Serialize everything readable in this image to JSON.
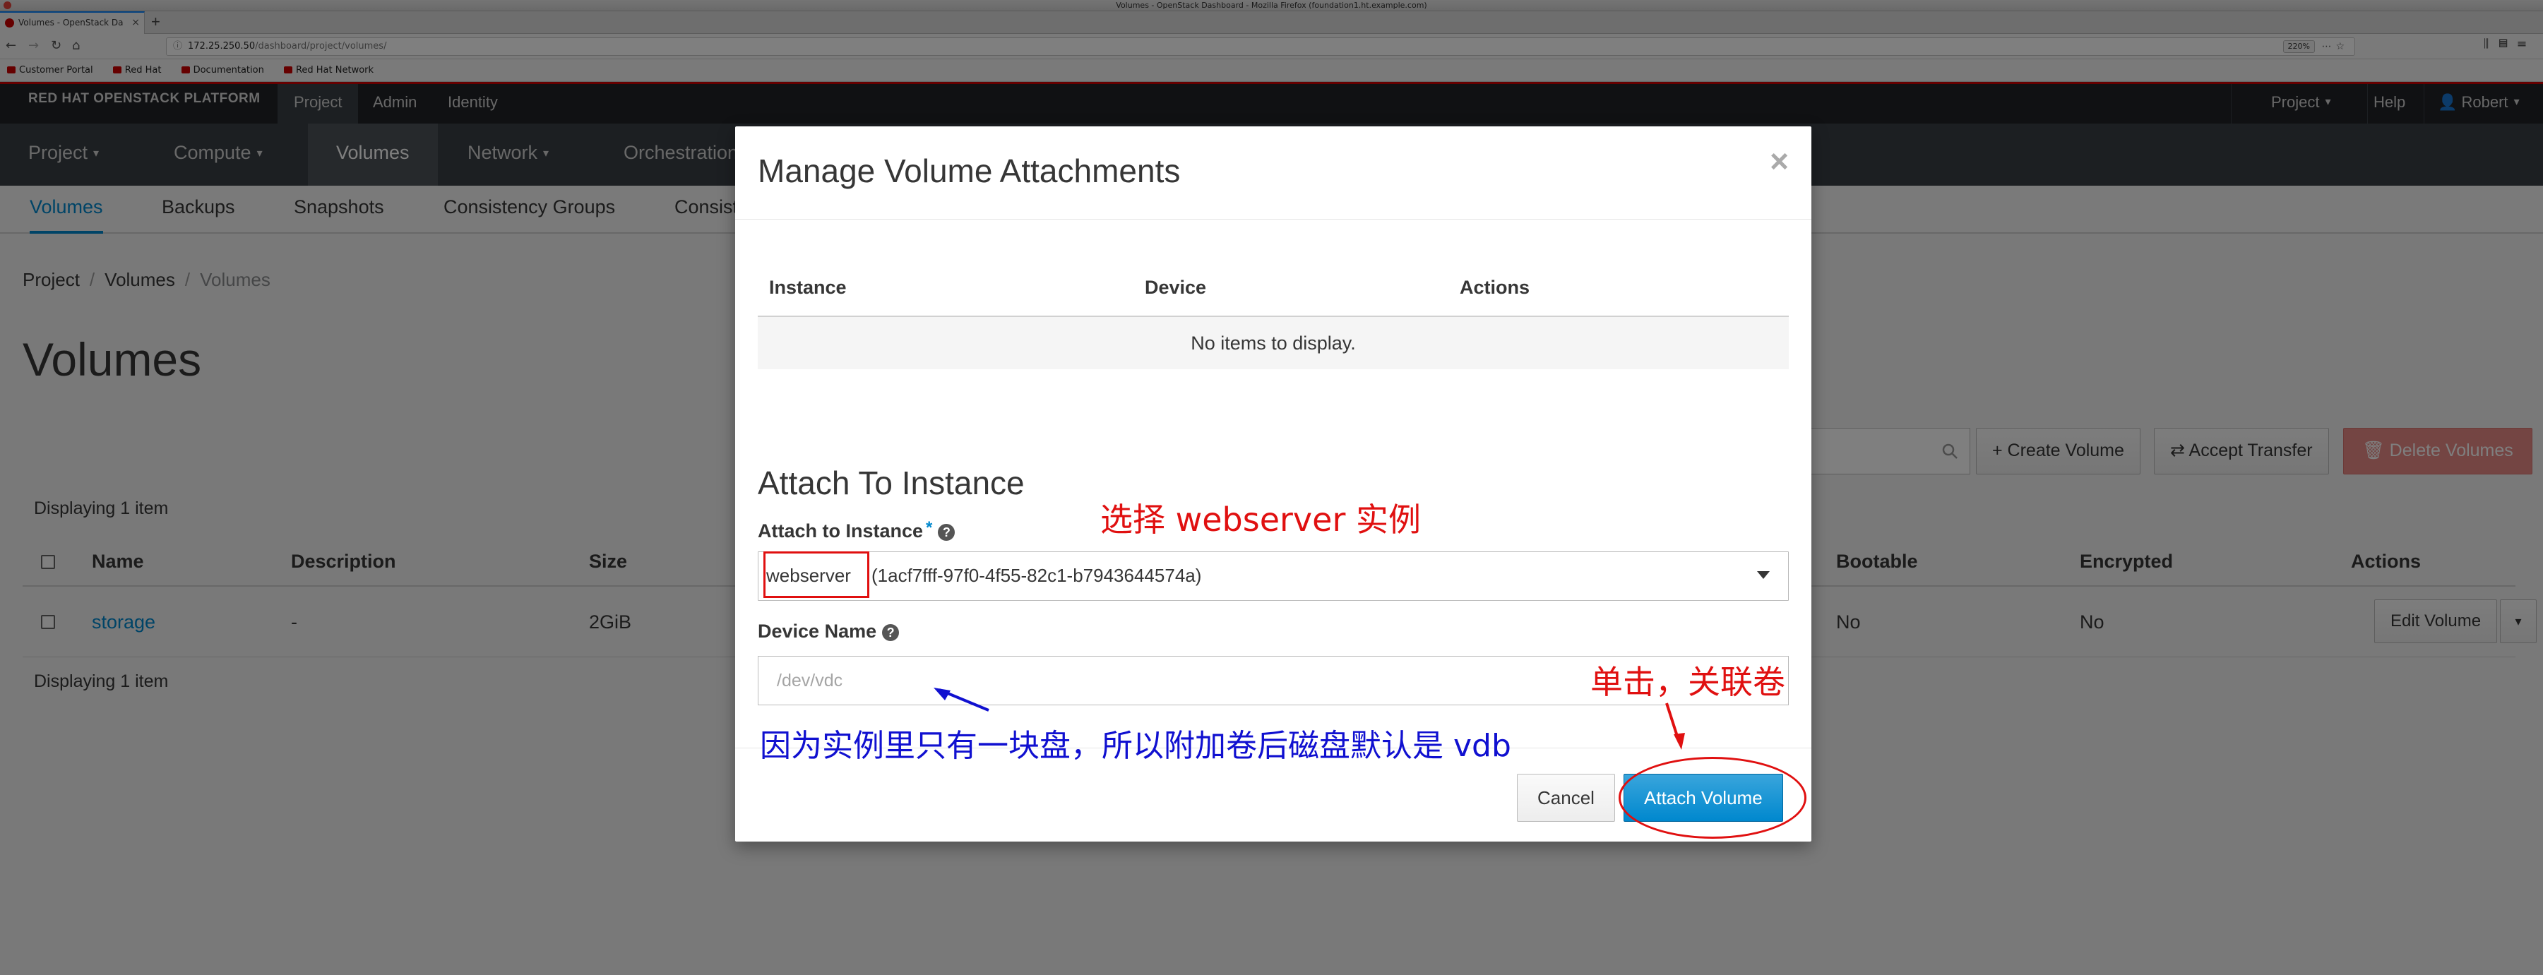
{
  "window": {
    "title": "Volumes - OpenStack Dashboard - Mozilla Firefox (foundation1.ht.example.com)"
  },
  "browser": {
    "tab_title": "Volumes - OpenStack Da",
    "tab_close": "×",
    "new_tab": "+",
    "url_host": "172.25.250.50",
    "url_path": "/dashboard/project/volumes/",
    "zoom": "220%",
    "bookmarks": [
      "Customer Portal",
      "Red Hat",
      "Documentation",
      "Red Hat Network"
    ]
  },
  "topnav": {
    "brand": "RED HAT OPENSTACK PLATFORM",
    "items": [
      "Project",
      "Admin",
      "Identity"
    ],
    "right": {
      "project": "Project",
      "help": "Help",
      "user": "Robert"
    }
  },
  "secnav": {
    "items": [
      "Project",
      "Compute",
      "Volumes",
      "Network",
      "Orchestration"
    ]
  },
  "tertnav": {
    "items": [
      "Volumes",
      "Backups",
      "Snapshots",
      "Consistency Groups",
      "Consist"
    ]
  },
  "page": {
    "breadcrumb": [
      "Project",
      "Volumes",
      "Volumes"
    ],
    "breadcrumb_sep": "/",
    "title": "Volumes",
    "buttons": {
      "create": "+ Create Volume",
      "accept": "⇄ Accept Transfer",
      "delete": "🗑 Delete Volumes"
    },
    "displaying_top": "Displaying 1 item",
    "displaying_bottom": "Displaying 1 item",
    "columns": [
      "Name",
      "Description",
      "Size",
      "Bootable",
      "Encrypted",
      "Actions"
    ],
    "rows": [
      {
        "name": "storage",
        "description": "-",
        "size": "2GiB",
        "bootable": "No",
        "encrypted": "No",
        "action": "Edit Volume"
      }
    ],
    "caret": "▾"
  },
  "modal": {
    "title": "Manage Volume Attachments",
    "close": "×",
    "table_columns": [
      "Instance",
      "Device",
      "Actions"
    ],
    "empty_text": "No items to display.",
    "section_title": "Attach To Instance",
    "attach_label": "Attach to Instance",
    "required_mark": "*",
    "help": "?",
    "instance_name": "webserver",
    "instance_id": "(1acf7fff-97f0-4f55-82c1-b7943644574a)",
    "device_label": "Device Name",
    "device_placeholder": "/dev/vdc",
    "cancel": "Cancel",
    "attach": "Attach Volume"
  },
  "annotations": {
    "select_instance": "选择 webserver 实例",
    "click_attach": "单击，关联卷",
    "note": "因为实例里只有一块盘，所以附加卷后磁盘默认是 vdb"
  },
  "colors": {
    "accent": "#0088ce",
    "brand_red": "#cc0000",
    "annotation_red": "#e01010",
    "annotation_blue": "#1010d0"
  }
}
